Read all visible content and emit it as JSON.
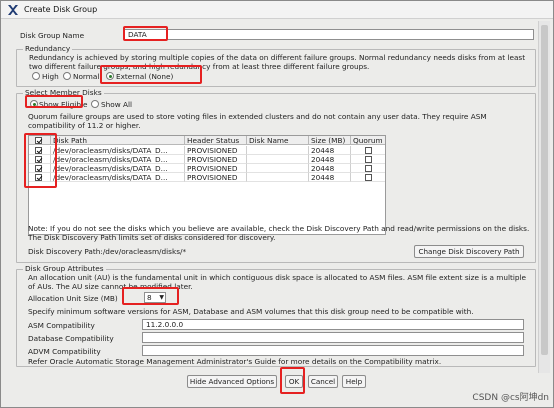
{
  "window": {
    "title": "Create Disk Group"
  },
  "disk_group": {
    "name_label": "Disk Group Name",
    "name_value": "DATA"
  },
  "redundancy": {
    "legend": "Redundancy",
    "description": "Redundancy is achieved by storing multiple copies of the data on different failure groups. Normal redundancy needs disks from at least two different failure groups, and high redundancy from at least three different failure groups.",
    "options": [
      {
        "label": "High",
        "selected": false
      },
      {
        "label": "Normal",
        "selected": false
      },
      {
        "label": "External (None)",
        "selected": true
      }
    ]
  },
  "member_disks": {
    "legend": "Select Member Disks",
    "filters": [
      {
        "label": "Show Eligible",
        "selected": true
      },
      {
        "label": "Show All",
        "selected": false
      }
    ],
    "quorum_note": "Quorum failure groups are used to store voting files in extended clusters and do not contain any user data. They require ASM compatibility of 11.2 or higher.",
    "columns": [
      "Disk Path",
      "Header Status",
      "Disk Name",
      "Size (MB)",
      "Quorum"
    ],
    "rows": [
      {
        "path": "/dev/oracleasm/disks/DATA_D...",
        "status": "PROVISIONED",
        "name": "",
        "size": "20448",
        "checked": true,
        "quorum": false
      },
      {
        "path": "/dev/oracleasm/disks/DATA_D...",
        "status": "PROVISIONED",
        "name": "",
        "size": "20448",
        "checked": true,
        "quorum": false
      },
      {
        "path": "/dev/oracleasm/disks/DATA_D...",
        "status": "PROVISIONED",
        "name": "",
        "size": "20448",
        "checked": true,
        "quorum": false
      },
      {
        "path": "/dev/oracleasm/disks/DATA_D...",
        "status": "PROVISIONED",
        "name": "",
        "size": "20448",
        "checked": true,
        "quorum": false
      }
    ],
    "note": "Note: If you do not see the disks which you believe are available, check the Disk Discovery Path and read/write permissions on the disks. The Disk Discovery Path limits set of disks considered for discovery.",
    "discovery_path": "Disk Discovery Path:/dev/oracleasm/disks/*",
    "change_path_button": "Change Disk Discovery Path"
  },
  "attributes": {
    "legend": "Disk Group Attributes",
    "au_description": "An allocation unit (AU) is the fundamental unit in which contiguous disk space is allocated to ASM files. ASM file extent size is a multiple of AUs. The AU size cannot be modified later.",
    "au_label": "Allocation Unit Size (MB)",
    "au_value": "8",
    "compat_description": "Specify minimum software versions for ASM, Database and ASM volumes that this disk group need to be compatible with.",
    "asm_compat_label": "ASM Compatibility",
    "asm_compat_value": "11.2.0.0.0",
    "db_compat_label": "Database Compatibility",
    "db_compat_value": "",
    "advm_compat_label": "ADVM Compatibility",
    "advm_compat_value": "",
    "refer_text": "Refer Oracle Automatic Storage Management Administrator's Guide for more details on the Compatibility matrix."
  },
  "buttons": {
    "hide_advanced": "Hide Advanced Options",
    "ok": "OK",
    "cancel": "Cancel",
    "help": "Help"
  },
  "watermark": "CSDN @cs阿坤dn",
  "colors": {
    "highlight": "#e52121",
    "radio_selected": "#2a7a2a"
  }
}
